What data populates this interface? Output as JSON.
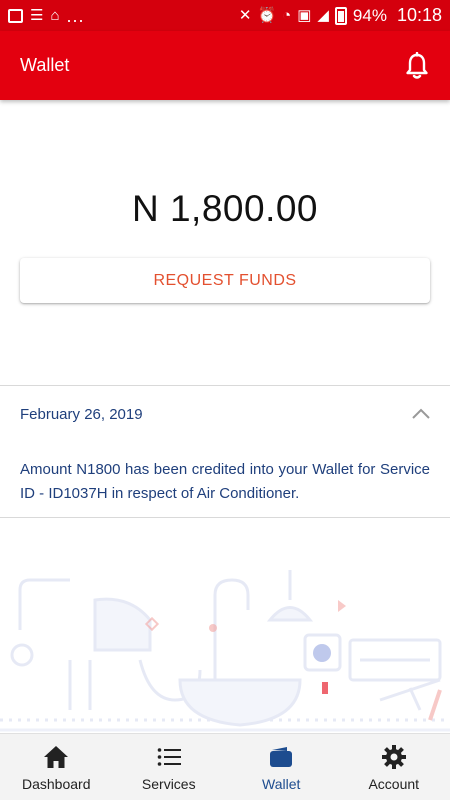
{
  "status_bar": {
    "overflow": "...",
    "battery_percent": "94%",
    "time": "10:18"
  },
  "app_bar": {
    "title": "Wallet",
    "notification_icon": "bell-icon"
  },
  "wallet": {
    "balance": "N 1,800.00",
    "request_button_label": "REQUEST FUNDS"
  },
  "transaction": {
    "date": "February 26, 2019",
    "message": "Amount N1800 has been credited into your Wallet for Service ID - ID1037H in respect of Air Conditioner.",
    "expanded": true
  },
  "bottom_nav": {
    "items": [
      {
        "label": "Dashboard",
        "icon": "home-icon"
      },
      {
        "label": "Services",
        "icon": "list-icon"
      },
      {
        "label": "Wallet",
        "icon": "wallet-icon"
      },
      {
        "label": "Account",
        "icon": "gear-icon"
      }
    ],
    "active_index": 2
  },
  "colors": {
    "brand_red": "#e3000f",
    "accent_orange": "#e3502f",
    "text_blue": "#1f3f7c",
    "active_nav_blue": "#1d4c8f"
  }
}
